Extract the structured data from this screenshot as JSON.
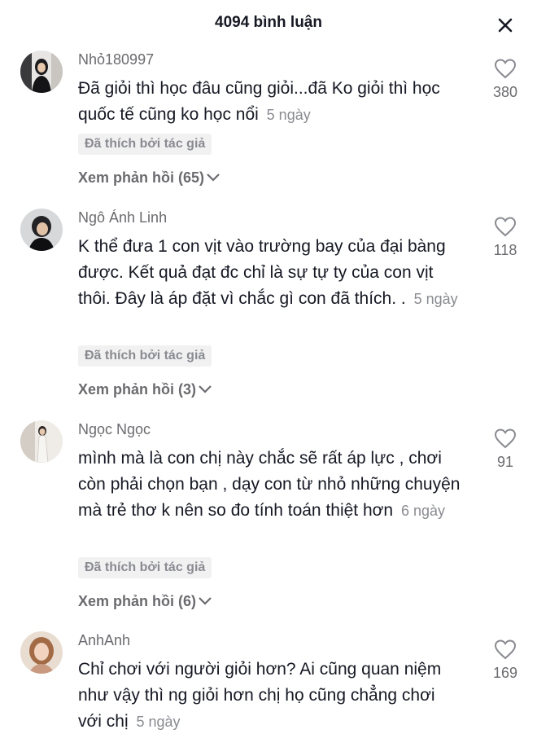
{
  "header": {
    "title": "4094 bình luận"
  },
  "comments": [
    {
      "username": "Nhỏ180997",
      "text": "Đã giỏi thì học đâu cũng giỏi...đã Ko giỏi thì học quốc tế cũng ko học nổi",
      "date": "5 ngày",
      "liked_badge": "Đã thích bởi tác giả",
      "replies": "Xem phản hồi (65)",
      "likes": "380"
    },
    {
      "username": "Ngô Ánh Linh",
      "text": "K thể đưa 1 con vịt vào trường bay của đại bàng được. Kết quả đạt đc chỉ là sự tự ty của con vịt thôi. Đây là áp đặt vì chắc gì con đã thích. .",
      "date": "5 ngày",
      "liked_badge": "Đã thích bởi tác giả",
      "replies": "Xem phản hồi (3)",
      "likes": "118"
    },
    {
      "username": "Ngọc Ngọc",
      "text": "mình mà là con chị này chắc sẽ rất áp lực , chơi còn phải chọn bạn , dạy con từ nhỏ những chuyện mà trẻ thơ k nên so đo tính toán thiệt hơn",
      "date": "6 ngày",
      "liked_badge": "Đã thích bởi tác giả",
      "replies": "Xem phản hồi (6)",
      "likes": "91"
    },
    {
      "username": "AnhAnh",
      "text": "Chỉ chơi với người giỏi hơn? Ai cũng quan niệm như vậy thì ng giỏi hơn chị họ cũng chẳng chơi với chị",
      "date": "5 ngày",
      "likes": "169"
    }
  ]
}
